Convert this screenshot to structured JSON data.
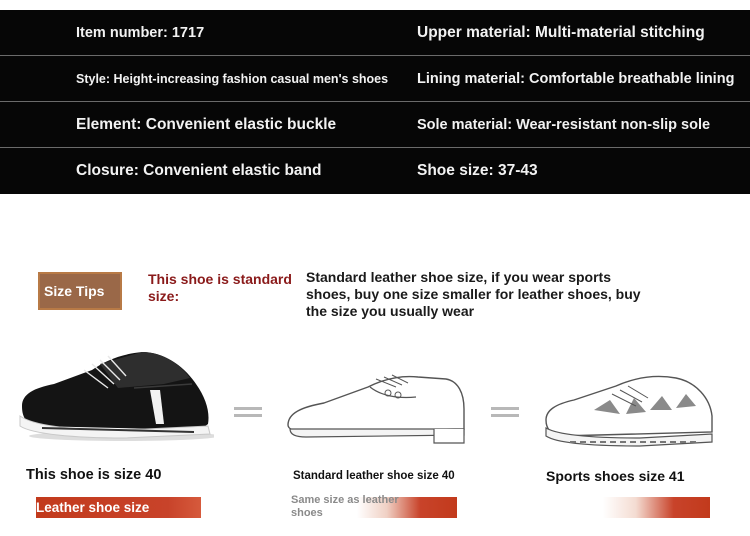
{
  "specs": {
    "rows": [
      {
        "left": "Item number: 1717",
        "right": "Upper material: Multi-material stitching"
      },
      {
        "left": "Style: Height-increasing fashion casual men's shoes",
        "right": "Lining material: Comfortable breathable lining"
      },
      {
        "left": "Element: Convenient elastic buckle",
        "right": "Sole material: Wear-resistant non-slip sole"
      },
      {
        "left": "Closure: Convenient elastic band",
        "right": "Shoe size: 37-43"
      }
    ]
  },
  "size_tips": {
    "badge": "Size Tips",
    "standard_label": "This shoe is standard size:",
    "description": "Standard leather shoe size, if you wear sports shoes, buy one size smaller for leather shoes, buy the size you usually wear"
  },
  "shoes": {
    "this_shoe": {
      "caption": "This shoe is size 40",
      "bar": "Leather shoe size"
    },
    "leather_shoe": {
      "caption": "Standard leather shoe size 40",
      "bar": "Same size as leather shoes"
    },
    "sports_shoe": {
      "caption": "Sports shoes size 41"
    }
  },
  "colors": {
    "table_bg": "#060606",
    "badge_bg": "#9a6848",
    "accent_red": "#8a1a1a",
    "bar_red": "#c23a1c"
  }
}
